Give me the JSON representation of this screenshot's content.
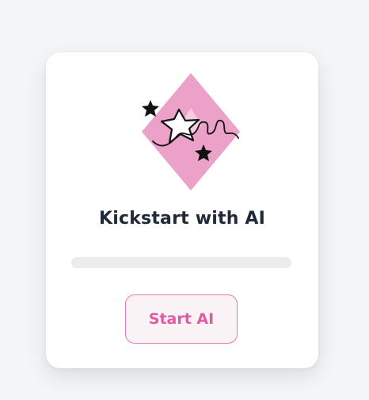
{
  "card": {
    "title": "Kickstart with AI",
    "illustration_icon": "sparkle-star-diamond-icon",
    "progress": 0,
    "start_button_label": "Start AI"
  },
  "colors": {
    "accent_pink": "#e05aa2",
    "diamond_pink": "#eba1c8",
    "progress_track": "#ebeced",
    "title_text": "#1f2937"
  }
}
